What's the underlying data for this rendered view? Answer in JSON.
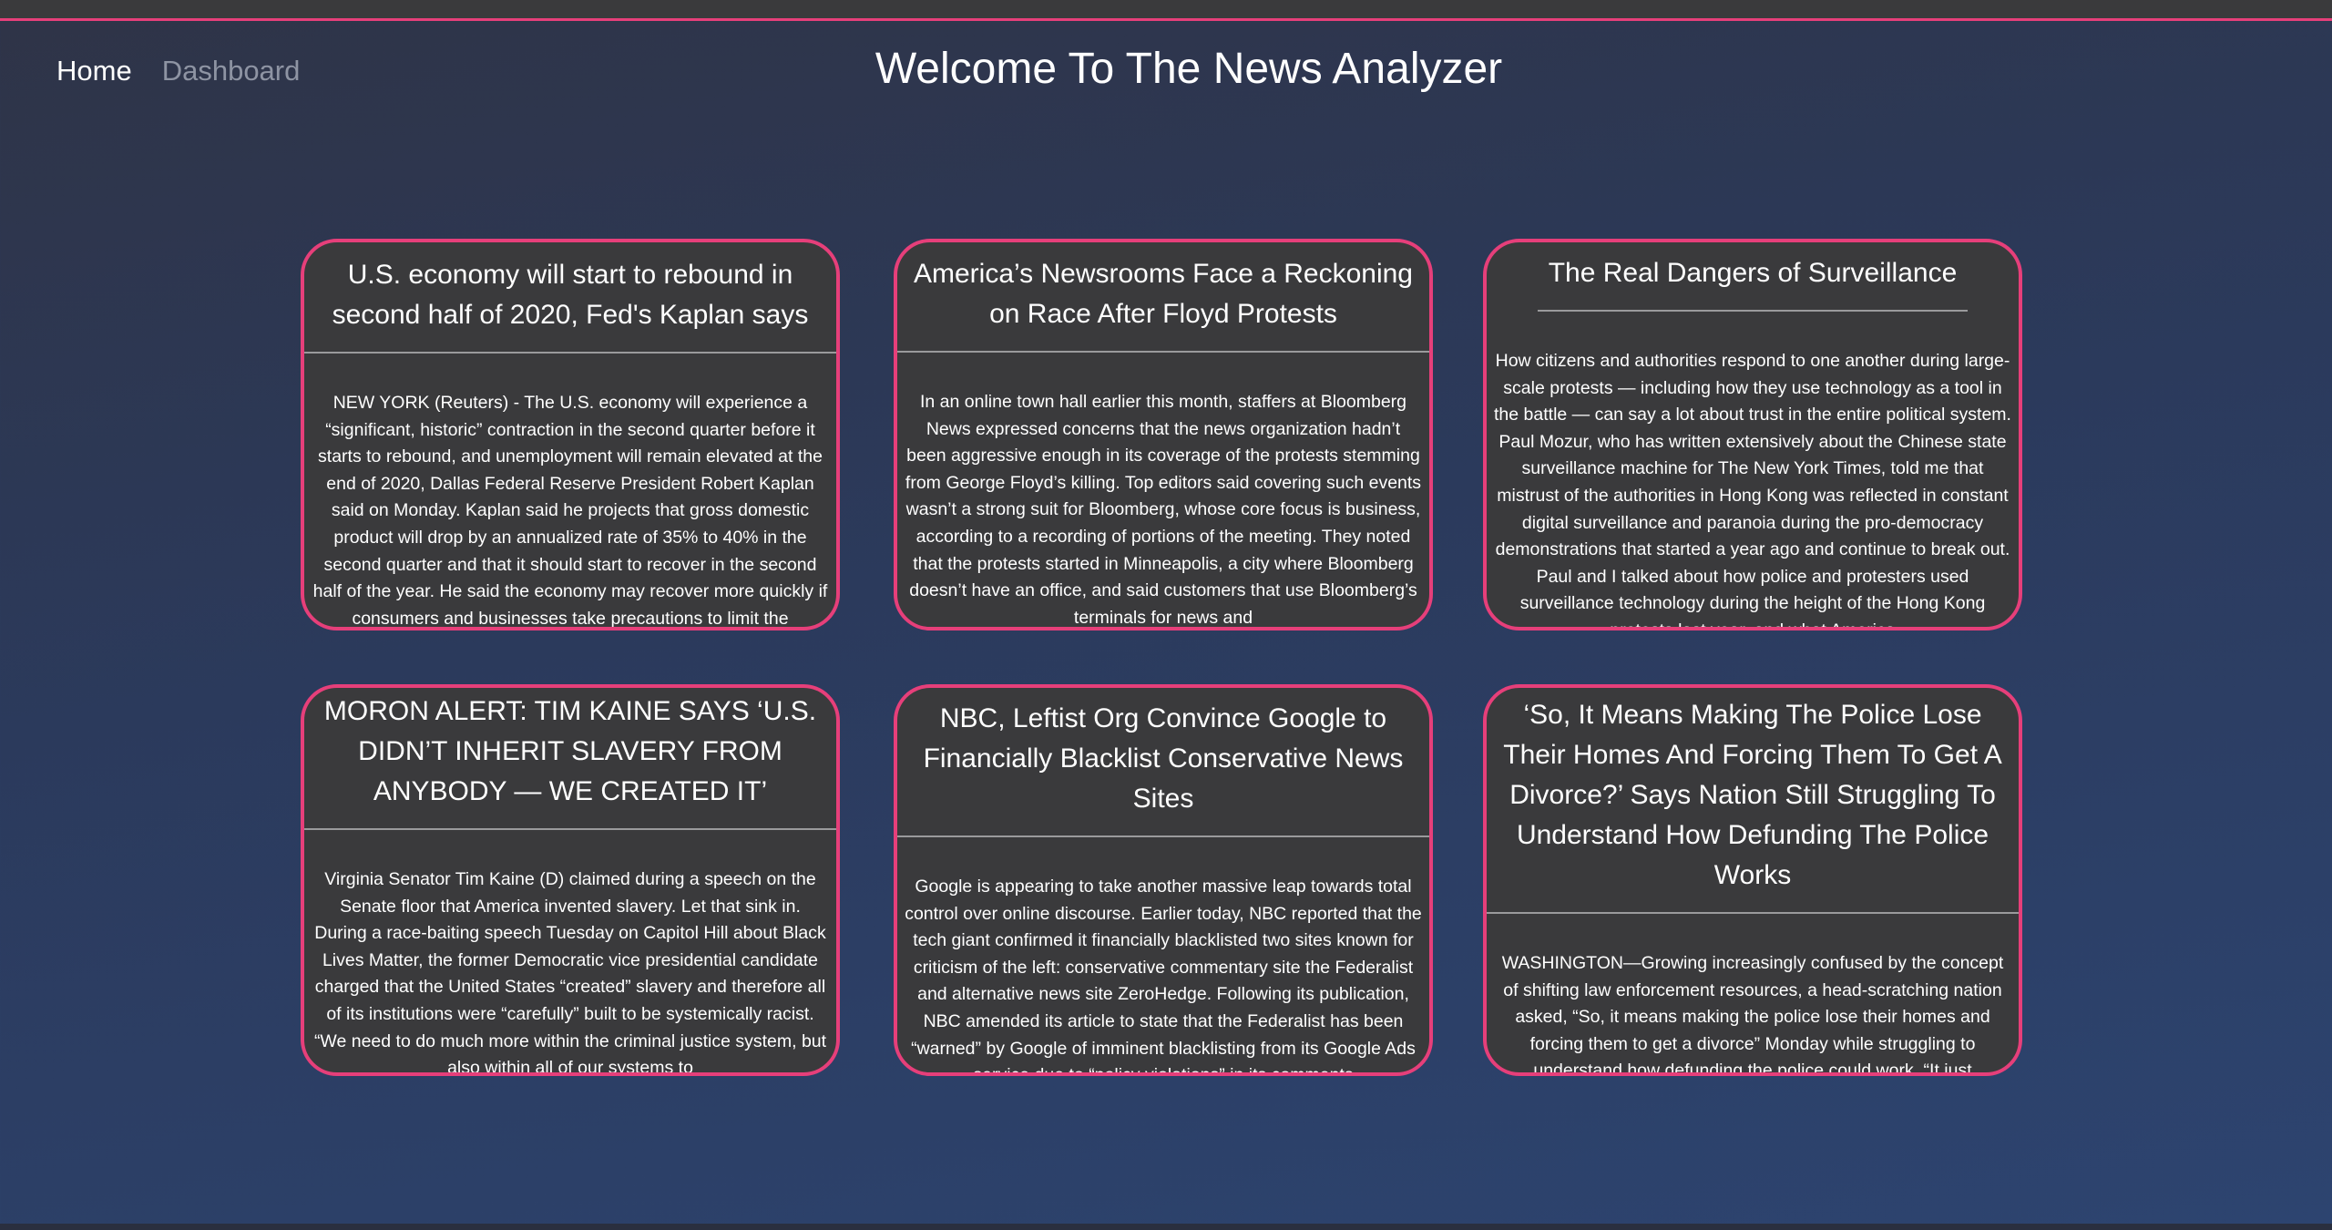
{
  "nav": {
    "home_label": "Home",
    "dashboard_label": "Dashboard"
  },
  "page_title": "Welcome To The News Analyzer",
  "colors": {
    "accent": "#e63f7a",
    "card_background": "#3a3a3c",
    "nav_inactive": "#8e94a3"
  },
  "articles": [
    {
      "title": "U.S. economy will start to rebound in second half of 2020, Fed's Kaplan says",
      "body": "NEW YORK (Reuters) - The U.S. economy will experience a “significant, historic” contraction in the second quarter before it starts to rebound, and unemployment will remain elevated at the end of 2020, Dallas Federal Reserve President Robert Kaplan said on Monday. Kaplan said he projects that gross domestic product will drop by an annualized rate of 35% to 40% in the second quarter and that it should start to recover in the second half of the year. He said the economy may recover more quickly if consumers and businesses take precautions to limit the"
    },
    {
      "title": "America’s Newsrooms Face a Reckoning on Race After Floyd Protests",
      "body": "In an online town hall earlier this month, staffers at Bloomberg News expressed concerns that the news organization hadn’t been aggressive enough in its coverage of the protests stemming from George Floyd’s killing. Top editors said covering such events wasn’t a strong suit for Bloomberg, whose core focus is business, according to a recording of portions of the meeting. They noted that the protests started in Minneapolis, a city where Bloomberg doesn’t have an office, and said customers that use Bloomberg’s terminals for news and"
    },
    {
      "title": "The Real Dangers of Surveillance",
      "body": "How citizens and authorities respond to one another during large-scale protests — including how they use technology as a tool in the battle — can say a lot about trust in the entire political system. Paul Mozur, who has written extensively about the Chinese state surveillance machine for The New York Times, told me that mistrust of the authorities in Hong Kong was reflected in constant digital surveillance and paranoia during the pro-democracy demonstrations that started a year ago and continue to break out. Paul and I talked about how police and protesters used surveillance technology during the height of the Hong Kong protests last year, and what America"
    },
    {
      "title": "MORON ALERT: TIM KAINE SAYS ‘U.S. DIDN’T INHERIT SLAVERY FROM ANYBODY — WE CREATED IT’",
      "body": "Virginia Senator Tim Kaine (D) claimed during a speech on the Senate floor that America invented slavery. Let that sink in. During a race-baiting speech Tuesday on Capitol Hill about Black Lives Matter, the former Democratic vice presidential candidate charged that the United States “created” slavery and therefore all of its institutions were “carefully” built to be systemically racist. “We need to do much more within the criminal justice system, but also within all of our systems to"
    },
    {
      "title": "NBC, Leftist Org Convince Google to Financially Blacklist Conservative News Sites",
      "body": "Google is appearing to take another massive leap towards total control over online discourse. Earlier today, NBC reported that the tech giant confirmed it financially blacklisted two sites known for criticism of the left: conservative commentary site the Federalist and alternative news site ZeroHedge. Following its publication, NBC amended its article to state that the Federalist has been “warned” by Google of imminent blacklisting from its Google Ads service due to “policy violations” in its comments"
    },
    {
      "title": "‘So, It Means Making The Police Lose Their Homes And Forcing Them To Get A Divorce?’ Says Nation Still Struggling To Understand How Defunding The Police Works",
      "body": "WASHINGTON—Growing increasingly confused by the concept of shifting law enforcement resources, a head-scratching nation asked, “So, it means making the police lose their homes and forcing them to get a divorce” Monday while struggling to understand how defunding the police could work. “It just"
    }
  ]
}
